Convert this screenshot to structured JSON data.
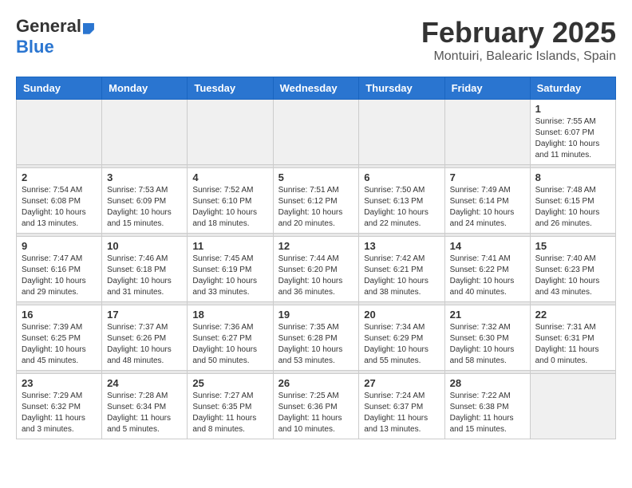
{
  "logo": {
    "general": "General",
    "blue": "Blue"
  },
  "title": "February 2025",
  "location": "Montuiri, Balearic Islands, Spain",
  "weekdays": [
    "Sunday",
    "Monday",
    "Tuesday",
    "Wednesday",
    "Thursday",
    "Friday",
    "Saturday"
  ],
  "weeks": [
    [
      {
        "day": "",
        "info": ""
      },
      {
        "day": "",
        "info": ""
      },
      {
        "day": "",
        "info": ""
      },
      {
        "day": "",
        "info": ""
      },
      {
        "day": "",
        "info": ""
      },
      {
        "day": "",
        "info": ""
      },
      {
        "day": "1",
        "info": "Sunrise: 7:55 AM\nSunset: 6:07 PM\nDaylight: 10 hours\nand 11 minutes."
      }
    ],
    [
      {
        "day": "2",
        "info": "Sunrise: 7:54 AM\nSunset: 6:08 PM\nDaylight: 10 hours\nand 13 minutes."
      },
      {
        "day": "3",
        "info": "Sunrise: 7:53 AM\nSunset: 6:09 PM\nDaylight: 10 hours\nand 15 minutes."
      },
      {
        "day": "4",
        "info": "Sunrise: 7:52 AM\nSunset: 6:10 PM\nDaylight: 10 hours\nand 18 minutes."
      },
      {
        "day": "5",
        "info": "Sunrise: 7:51 AM\nSunset: 6:12 PM\nDaylight: 10 hours\nand 20 minutes."
      },
      {
        "day": "6",
        "info": "Sunrise: 7:50 AM\nSunset: 6:13 PM\nDaylight: 10 hours\nand 22 minutes."
      },
      {
        "day": "7",
        "info": "Sunrise: 7:49 AM\nSunset: 6:14 PM\nDaylight: 10 hours\nand 24 minutes."
      },
      {
        "day": "8",
        "info": "Sunrise: 7:48 AM\nSunset: 6:15 PM\nDaylight: 10 hours\nand 26 minutes."
      }
    ],
    [
      {
        "day": "9",
        "info": "Sunrise: 7:47 AM\nSunset: 6:16 PM\nDaylight: 10 hours\nand 29 minutes."
      },
      {
        "day": "10",
        "info": "Sunrise: 7:46 AM\nSunset: 6:18 PM\nDaylight: 10 hours\nand 31 minutes."
      },
      {
        "day": "11",
        "info": "Sunrise: 7:45 AM\nSunset: 6:19 PM\nDaylight: 10 hours\nand 33 minutes."
      },
      {
        "day": "12",
        "info": "Sunrise: 7:44 AM\nSunset: 6:20 PM\nDaylight: 10 hours\nand 36 minutes."
      },
      {
        "day": "13",
        "info": "Sunrise: 7:42 AM\nSunset: 6:21 PM\nDaylight: 10 hours\nand 38 minutes."
      },
      {
        "day": "14",
        "info": "Sunrise: 7:41 AM\nSunset: 6:22 PM\nDaylight: 10 hours\nand 40 minutes."
      },
      {
        "day": "15",
        "info": "Sunrise: 7:40 AM\nSunset: 6:23 PM\nDaylight: 10 hours\nand 43 minutes."
      }
    ],
    [
      {
        "day": "16",
        "info": "Sunrise: 7:39 AM\nSunset: 6:25 PM\nDaylight: 10 hours\nand 45 minutes."
      },
      {
        "day": "17",
        "info": "Sunrise: 7:37 AM\nSunset: 6:26 PM\nDaylight: 10 hours\nand 48 minutes."
      },
      {
        "day": "18",
        "info": "Sunrise: 7:36 AM\nSunset: 6:27 PM\nDaylight: 10 hours\nand 50 minutes."
      },
      {
        "day": "19",
        "info": "Sunrise: 7:35 AM\nSunset: 6:28 PM\nDaylight: 10 hours\nand 53 minutes."
      },
      {
        "day": "20",
        "info": "Sunrise: 7:34 AM\nSunset: 6:29 PM\nDaylight: 10 hours\nand 55 minutes."
      },
      {
        "day": "21",
        "info": "Sunrise: 7:32 AM\nSunset: 6:30 PM\nDaylight: 10 hours\nand 58 minutes."
      },
      {
        "day": "22",
        "info": "Sunrise: 7:31 AM\nSunset: 6:31 PM\nDaylight: 11 hours\nand 0 minutes."
      }
    ],
    [
      {
        "day": "23",
        "info": "Sunrise: 7:29 AM\nSunset: 6:32 PM\nDaylight: 11 hours\nand 3 minutes."
      },
      {
        "day": "24",
        "info": "Sunrise: 7:28 AM\nSunset: 6:34 PM\nDaylight: 11 hours\nand 5 minutes."
      },
      {
        "day": "25",
        "info": "Sunrise: 7:27 AM\nSunset: 6:35 PM\nDaylight: 11 hours\nand 8 minutes."
      },
      {
        "day": "26",
        "info": "Sunrise: 7:25 AM\nSunset: 6:36 PM\nDaylight: 11 hours\nand 10 minutes."
      },
      {
        "day": "27",
        "info": "Sunrise: 7:24 AM\nSunset: 6:37 PM\nDaylight: 11 hours\nand 13 minutes."
      },
      {
        "day": "28",
        "info": "Sunrise: 7:22 AM\nSunset: 6:38 PM\nDaylight: 11 hours\nand 15 minutes."
      },
      {
        "day": "",
        "info": ""
      }
    ]
  ]
}
